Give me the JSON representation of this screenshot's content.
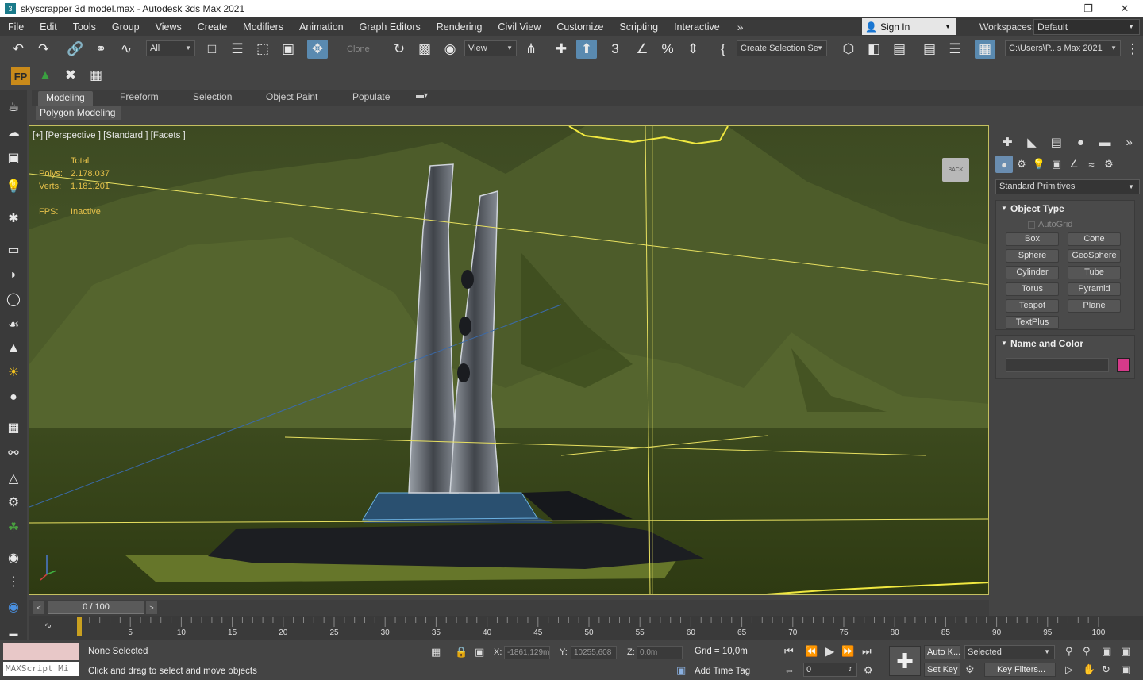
{
  "window": {
    "title": "skyscrapper 3d model.max - Autodesk 3ds Max 2021",
    "minimize": "—",
    "restore": "❐",
    "close": "✕"
  },
  "menu": {
    "items": [
      "File",
      "Edit",
      "Tools",
      "Group",
      "Views",
      "Create",
      "Modifiers",
      "Animation",
      "Graph Editors",
      "Rendering",
      "Civil View",
      "Customize",
      "Scripting",
      "Interactive"
    ],
    "more": "»",
    "sign_in": "Sign In",
    "workspaces_label": "Workspaces:",
    "workspace_value": "Default"
  },
  "toolbar": {
    "filter_value": "All",
    "clone_label": "Clone",
    "ref_coord_value": "View",
    "selection_set_value": "Create Selection Se",
    "project_path": "C:\\Users\\P...s Max 2021"
  },
  "toolbar2": {
    "fp_label": "FP"
  },
  "ribbon": {
    "tabs": [
      "Modeling",
      "Freeform",
      "Selection",
      "Object Paint",
      "Populate"
    ],
    "sub_label": "Polygon Modeling"
  },
  "viewport": {
    "label": "[+] [Perspective ] [Standard ] [Facets ]",
    "stats_header": "Total",
    "polys_label": "Polys:",
    "polys_value": "2.178.037",
    "verts_label": "Verts:",
    "verts_value": "1.181.201",
    "fps_label": "FPS:",
    "fps_value": "Inactive",
    "viewcube_label": "BACK"
  },
  "command_panel": {
    "category_value": "Standard Primitives",
    "object_type_title": "Object Type",
    "autogrid_label": "AutoGrid",
    "primitives": [
      "Box",
      "Cone",
      "Sphere",
      "GeoSphere",
      "Cylinder",
      "Tube",
      "Torus",
      "Pyramid",
      "Teapot",
      "Plane",
      "TextPlus"
    ],
    "name_color_title": "Name and Color",
    "object_color": "#d63a8a"
  },
  "timeline": {
    "frame_display": "0 / 100",
    "ticks": [
      "5",
      "10",
      "15",
      "20",
      "25",
      "30",
      "35",
      "40",
      "45",
      "50",
      "55",
      "60",
      "65",
      "70",
      "75",
      "80",
      "85",
      "90",
      "95",
      "100"
    ]
  },
  "status": {
    "maxscript_placeholder": "MAXScript Mi",
    "selection_status": "None Selected",
    "prompt": "Click and drag to select and move objects",
    "x_label": "X:",
    "x_value": "-1861,129m",
    "y_label": "Y:",
    "y_value": "10255,608",
    "z_label": "Z:",
    "z_value": "0,0m",
    "grid": "Grid = 10,0m",
    "add_time_tag": "Add Time Tag",
    "auto_key": "Auto K...",
    "set_key": "Set Key",
    "key_mode_value": "Selected",
    "key_filters": "Key Filters...",
    "current_frame": "0"
  }
}
